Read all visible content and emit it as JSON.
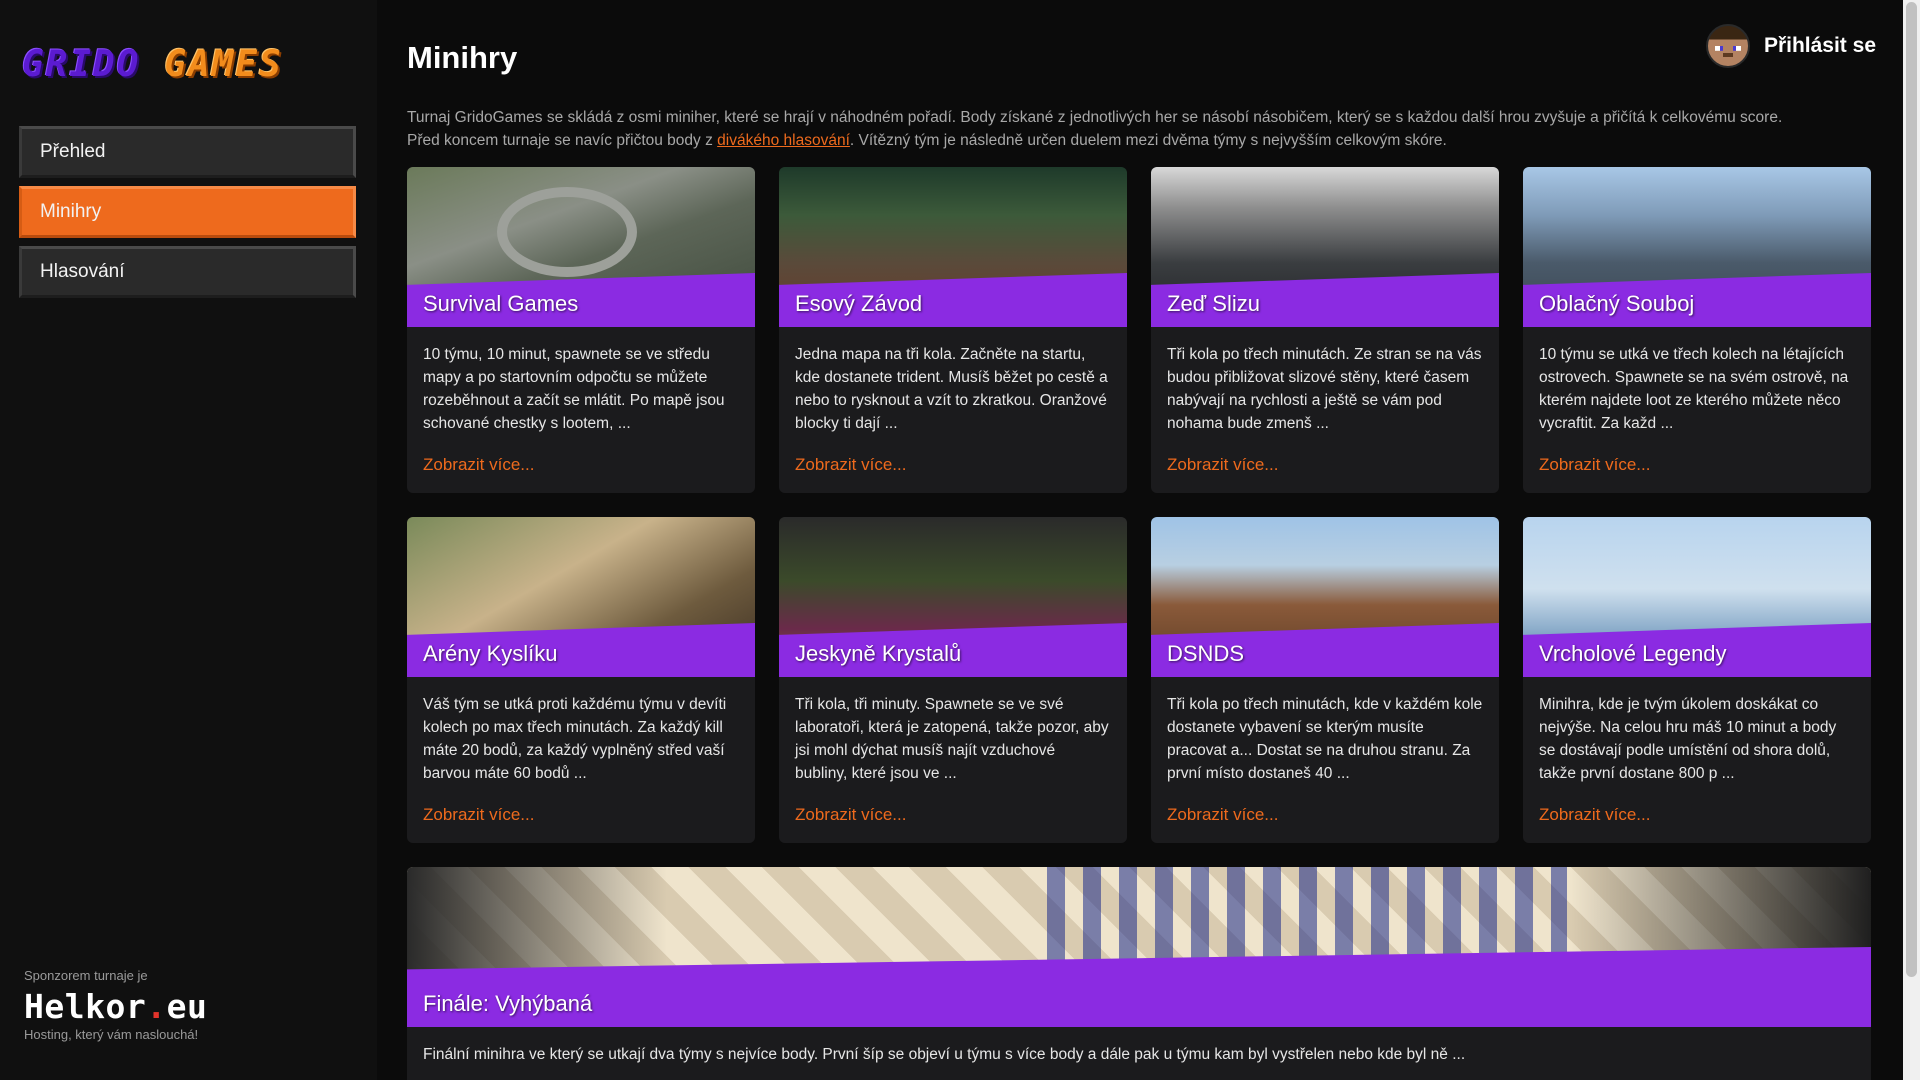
{
  "logo": {
    "word1": "GRIDO",
    "word2": "GAMES"
  },
  "nav": [
    {
      "label": "Přehled",
      "active": false
    },
    {
      "label": "Minihry",
      "active": true
    },
    {
      "label": "Hlasování",
      "active": false
    }
  ],
  "sponsor": {
    "label": "Sponzorem turnaje je",
    "brand_main": "Helkor",
    "brand_dot": ".",
    "brand_tld": "eu",
    "tagline": "Hosting, který vám naslouchá!"
  },
  "header": {
    "title": "Minihry",
    "login_label": "Přihlásit se"
  },
  "intro": {
    "line1": "Turnaj GridoGames se skládá z osmi miniher, které se hrají v náhodném pořadí. Body získané z jednotlivých her se násobí násobičem, který se s každou další hrou zvyšuje a přičítá k celkovému score.",
    "line2_before": "Před koncem turnaje se navíc přičtou body z ",
    "line2_link": "divákého hlasování",
    "line2_after": ". Vítězný tým je následně určen duelem mezi dvěma týmy s nejvyšším celkovým skóre."
  },
  "more_label": "Zobrazit více...",
  "games": [
    {
      "title": "Survival Games",
      "desc": "10 týmu, 10 minut, spawnete se ve středu mapy a po startovním odpočtu se můžete rozeběhnout a začít se mlátit. Po mapě jsou schované chestky s lootem, ..."
    },
    {
      "title": "Esový Závod",
      "desc": "Jedna mapa na tři kola. Začněte na startu, kde dostanete trident. Musíš běžet po cestě a nebo to rysknout a vzít to zkratkou. Oranžové blocky ti dají ..."
    },
    {
      "title": "Zeď Slizu",
      "desc": "Tři kola po třech minutách. Ze stran se na vás budou přibližovat slizové stěny, které časem nabývají na rychlosti a ještě se vám pod nohama bude zmenš ..."
    },
    {
      "title": "Oblačný Souboj",
      "desc": "10 týmu se utká ve třech kolech na létajících ostrovech. Spawnete se na svém ostrově, na kterém najdete loot ze kterého můžete něco vycraftit. Za každ ..."
    },
    {
      "title": "Arény Kyslíku",
      "desc": "Váš tým se utká proti každému týmu v devíti kolech po max třech minutách. Za každý kill máte 20 bodů, za každý vyplněný střed vaší barvou máte 60 bodů ..."
    },
    {
      "title": "Jeskyně Krystalů",
      "desc": "Tři kola, tři minuty. Spawnete se ve své laboratoři, která je zatopená, takže pozor, aby jsi mohl dýchat musíš najít vzduchové bubliny, které jsou ve ..."
    },
    {
      "title": "DSNDS",
      "desc": "Tři kola po třech minutách, kde v každém kole dostanete vybavení se kterým musíte pracovat a... Dostat se na druhou stranu. Za první místo dostaneš 40 ..."
    },
    {
      "title": "Vrcholové Legendy",
      "desc": "Minihra, kde je tvým úkolem doskákat co nejvýše. Na celou hru máš 10 minut a body se dostávají podle umístění od shora dolů, takže první dostane 800 p ..."
    }
  ],
  "finale": {
    "title": "Finále: Vyhýbaná",
    "desc": "Finální minihra ve který se utkají dva týmy s nejvíce body. První šíp se objeví u týmu s více body a dále pak u týmu kam byl vystřelen nebo kde byl ně ..."
  },
  "colors": {
    "accent": "#ee6a1d",
    "band": "#8b2be2",
    "card_bg": "#1b1b1d"
  }
}
